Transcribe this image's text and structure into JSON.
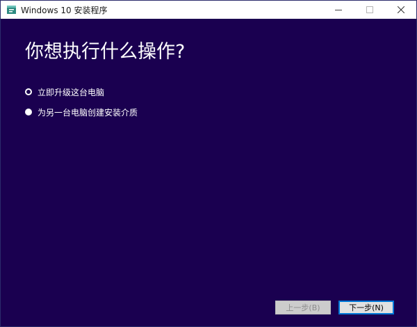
{
  "window": {
    "title": "Windows 10 安装程序"
  },
  "page": {
    "heading": "你想执行什么操作?",
    "options": [
      {
        "label": "立即升级这台电脑",
        "selected": true
      },
      {
        "label": "为另一台电脑创建安装介质",
        "selected": false
      }
    ]
  },
  "footer": {
    "back_label": "上一步(B)",
    "next_label": "下一步(N)"
  },
  "colors": {
    "background": "#1a0050",
    "accent": "#0078d7",
    "icon": "#2e8b82"
  },
  "icons": {
    "app": "setup-app-icon",
    "minimize": "minimize-icon",
    "maximize": "maximize-icon",
    "close": "close-icon"
  }
}
